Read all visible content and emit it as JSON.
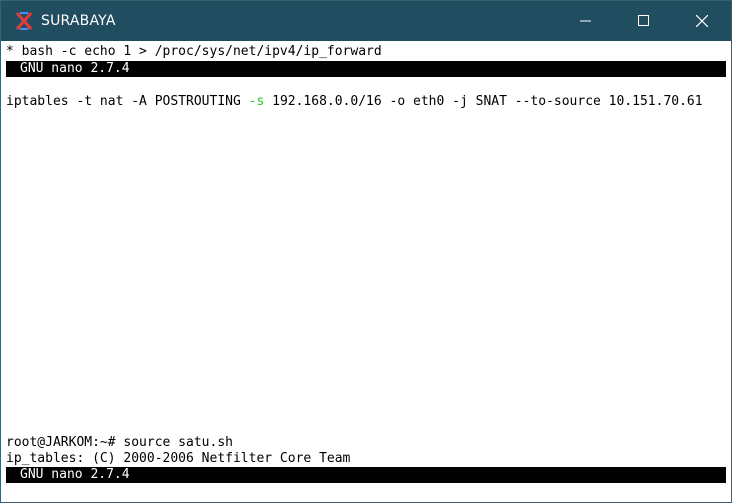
{
  "window": {
    "title": "SURABAYA",
    "icon": "app-logo-icon",
    "controls": [
      "minimize-icon",
      "maximize-icon",
      "close-icon"
    ]
  },
  "terminal": {
    "top_line": "* bash -c echo 1 > /proc/sys/net/ipv4/ip_forward",
    "top_bar": "GNU nano 2.7.4",
    "command": {
      "before": "iptables -t nat -A POSTROUTING ",
      "flag": "-s",
      "after": " 192.168.0.0/16 -o eth0 -j SNAT --to-source 10.151.70.61"
    },
    "prompt_line": "root@JARKOM:~# source satu.sh",
    "output_line": "ip_tables: (C) 2000-2006 Netfilter Core Team",
    "bottom_bar": "GNU nano 2.7.4"
  },
  "colors": {
    "titlebar": "#214d61",
    "highlight_flag": "#22c32a"
  }
}
